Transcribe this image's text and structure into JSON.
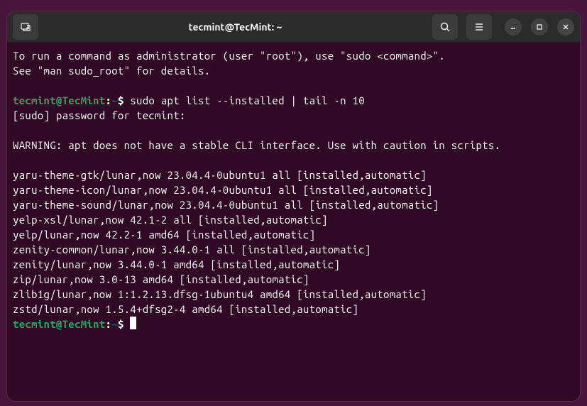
{
  "titlebar": {
    "title": "tecmint@TecMint: ~"
  },
  "terminal": {
    "intro_line1": "To run a command as administrator (user \"root\"), use \"sudo <command>\".",
    "intro_line2": "See \"man sudo_root\" for details.",
    "prompt": {
      "user_host": "tecmint@TecMint",
      "colon": ":",
      "tilde": "~",
      "dollar": "$"
    },
    "command1": " sudo apt list --installed | tail -n 10",
    "sudo_prompt": "[sudo] password for tecmint: ",
    "warning": "WARNING: apt does not have a stable CLI interface. Use with caution in scripts.",
    "packages": [
      "yaru-theme-gtk/lunar,now 23.04.4-0ubuntu1 all [installed,automatic]",
      "yaru-theme-icon/lunar,now 23.04.4-0ubuntu1 all [installed,automatic]",
      "yaru-theme-sound/lunar,now 23.04.4-0ubuntu1 all [installed,automatic]",
      "yelp-xsl/lunar,now 42.1-2 all [installed,automatic]",
      "yelp/lunar,now 42.2-1 amd64 [installed,automatic]",
      "zenity-common/lunar,now 3.44.0-1 all [installed,automatic]",
      "zenity/lunar,now 3.44.0-1 amd64 [installed,automatic]",
      "zip/lunar,now 3.0-13 amd64 [installed,automatic]",
      "zlib1g/lunar,now 1:1.2.13.dfsg-1ubuntu4 amd64 [installed,automatic]",
      "zstd/lunar,now 1.5.4+dfsg2-4 amd64 [installed,automatic]"
    ]
  }
}
